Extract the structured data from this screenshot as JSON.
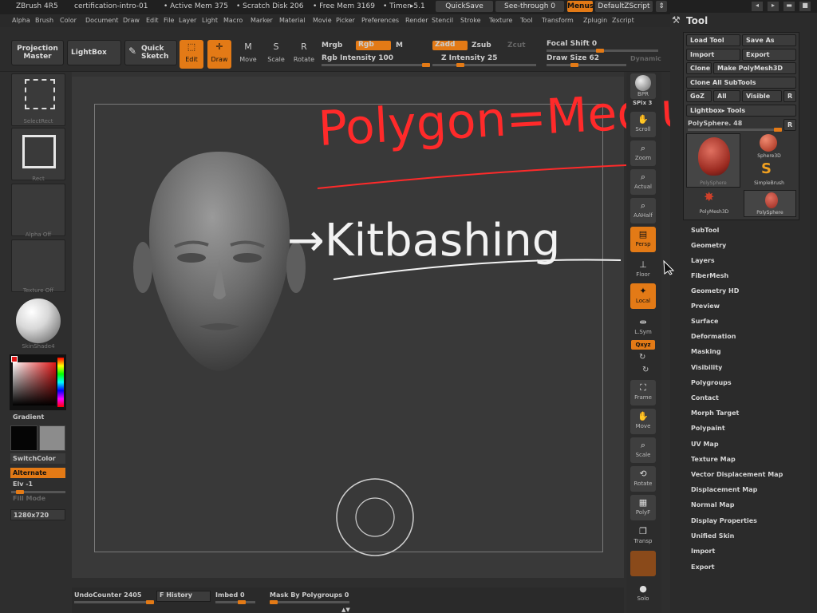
{
  "titlebar": {
    "app": "ZBrush 4R5",
    "doc": "certification-intro-01",
    "active_mem": "• Active Mem 375",
    "scratch": "• Scratch Disk 206",
    "free_mem": "• Free Mem 3169",
    "timer": "• Timer▸5.1",
    "quicksave": "QuickSave",
    "see_through": "See-through   0",
    "menus": "Menus",
    "default_zscript": "DefaultZScript"
  },
  "menubar": [
    "Alpha",
    "Brush",
    "Color",
    "Document",
    "Draw",
    "Edit",
    "File",
    "Layer",
    "Light",
    "Macro",
    "Marker",
    "Material",
    "Movie",
    "Picker",
    "Preferences",
    "Render",
    "Stencil",
    "Stroke",
    "Texture",
    "Tool",
    "Transform",
    "Zplugin",
    "Zscript"
  ],
  "toolbar": {
    "projection_master": "Projection Master",
    "lightbox": "LightBox",
    "quick_sketch": "Quick Sketch",
    "edit": "Edit",
    "draw": "Draw",
    "move": "Move",
    "scale": "Scale",
    "rotate": "Rotate",
    "mrgb": "Mrgb",
    "rgb": "Rgb",
    "m": "M",
    "zadd": "Zadd",
    "zsub": "Zsub",
    "zcut": "Zcut",
    "rgb_intensity": "Rgb Intensity 100",
    "z_intensity": "Z Intensity 25",
    "focal_shift": "Focal Shift 0",
    "draw_size": "Draw Size 62",
    "dynamic": "Dynamic"
  },
  "leftshelf": {
    "selectrect": "SelectRect",
    "rect": "Rect",
    "alpha_off": "Alpha Off",
    "texture_off": "Texture Off",
    "material": "SkinShade4",
    "gradient": "Gradient",
    "switchcolor": "SwitchColor",
    "alternate": "Alternate",
    "elv": "Elv -1",
    "fill_mode": "Fill Mode",
    "doc_size": "1280x720"
  },
  "annotations": {
    "line1": "Polygon=Medium",
    "line2": "→Kitbashing"
  },
  "rightshelf": [
    {
      "label": "BPR",
      "icon": "bpr-icon"
    },
    {
      "label": "SPix 3",
      "icon": "spix-icon"
    },
    {
      "label": "Scroll",
      "icon": "scroll-icon"
    },
    {
      "label": "Zoom",
      "icon": "zoom-icon"
    },
    {
      "label": "Actual",
      "icon": "actual-icon"
    },
    {
      "label": "AAHalf",
      "icon": "aahalf-icon"
    },
    {
      "label": "Persp",
      "icon": "persp-icon"
    },
    {
      "label": "Floor",
      "icon": "floor-icon"
    },
    {
      "label": "Local",
      "icon": "local-icon"
    },
    {
      "label": "L.Sym",
      "icon": "lsym-icon"
    },
    {
      "label": "Qxyz",
      "icon": "xyz-icon"
    },
    {
      "label": "Frame",
      "icon": "frame-icon"
    },
    {
      "label": "Move",
      "icon": "move-icon"
    },
    {
      "label": "Scale",
      "icon": "scale-icon"
    },
    {
      "label": "Rotate",
      "icon": "rotate-icon"
    },
    {
      "label": "PolyF",
      "icon": "polyf-icon"
    },
    {
      "label": "Transp",
      "icon": "transp-icon"
    },
    {
      "label": "Solo",
      "icon": "solo-icon"
    }
  ],
  "toolpanel": {
    "title": "Tool",
    "load_tool": "Load Tool",
    "save_as": "Save As",
    "import": "Import",
    "export": "Export",
    "clone": "Clone",
    "make_polymesh": "Make PolyMesh3D",
    "clone_all": "Clone All SubTools",
    "goz": "GoZ",
    "all": "All",
    "visible": "Visible",
    "r": "R",
    "lightbox_tools": "Lightbox▸ Tools",
    "polysphere_slider": "PolySphere. 48",
    "thumbs": [
      "PolySphere",
      "Sphere3D",
      "SimpleBrush",
      "PolyMesh3D",
      "PolySphere"
    ],
    "subpalettes": [
      "SubTool",
      "Geometry",
      "Layers",
      "FiberMesh",
      "Geometry HD",
      "Preview",
      "Surface",
      "Deformation",
      "Masking",
      "Visibility",
      "Polygroups",
      "Contact",
      "Morph Target",
      "Polypaint",
      "UV Map",
      "Texture Map",
      "Vector Displacement Map",
      "Displacement Map",
      "Normal Map",
      "Display Properties",
      "Unified Skin",
      "Import",
      "Export"
    ]
  },
  "statusbar": {
    "undo": "UndoCounter 2405",
    "history": "F History",
    "imbed": "Imbed 0",
    "mask_polygroups": "Mask By Polygroups 0"
  }
}
